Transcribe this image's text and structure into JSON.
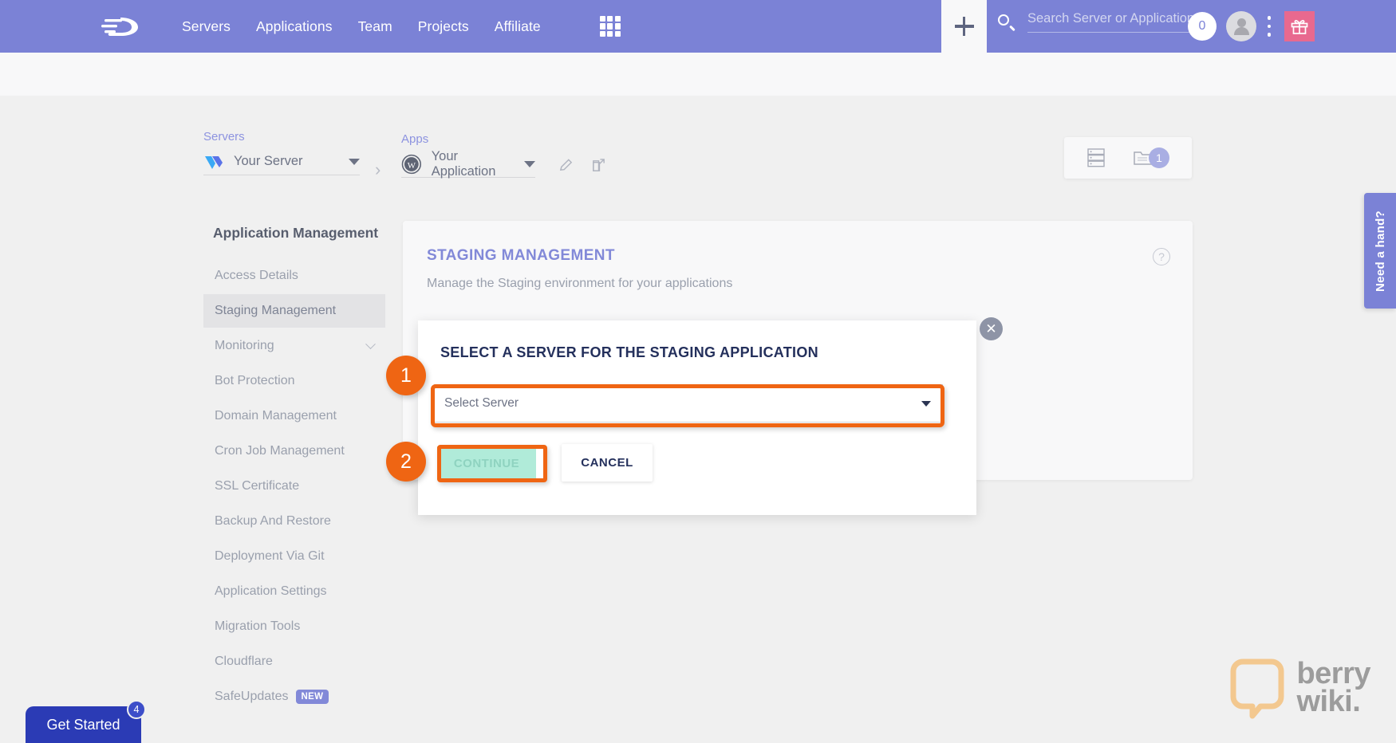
{
  "topnav": {
    "logo": "cloudways-logo",
    "links": [
      {
        "label": "Servers",
        "name": "nav-servers"
      },
      {
        "label": "Applications",
        "name": "nav-applications"
      },
      {
        "label": "Team",
        "name": "nav-team"
      },
      {
        "label": "Projects",
        "name": "nav-projects"
      },
      {
        "label": "Affiliate",
        "name": "nav-affiliate"
      }
    ],
    "grid_icon": "apps-grid-icon",
    "plus_icon": "plus-icon",
    "search": {
      "icon": "search-icon",
      "placeholder": "Search Server or Application",
      "value": ""
    },
    "notification_count": "0",
    "avatar_icon": "user-avatar-icon",
    "kebab_icon": "more-vertical-icon",
    "gift_icon": "gift-icon",
    "bg_color": "#7b82d6",
    "gift_color": "#e8698f"
  },
  "breadcrumb": {
    "server": {
      "label": "Servers",
      "value": "Your Server",
      "icon": "vultr-logo-icon"
    },
    "app": {
      "label": "Apps",
      "value": "Your Application",
      "icon": "wordpress-logo-icon"
    },
    "separator": "›",
    "edit_icon": "pencil-icon",
    "open_icon": "external-link-icon"
  },
  "view_toggle": {
    "list_icon": "server-list-icon",
    "folder_icon": "folder-icon",
    "folder_count": "1"
  },
  "sidebar": {
    "title": "Application Management",
    "items": [
      {
        "label": "Access Details",
        "name": "sidebar-item-access-details",
        "active": false
      },
      {
        "label": "Staging Management",
        "name": "sidebar-item-staging-management",
        "active": true
      },
      {
        "label": "Monitoring",
        "name": "sidebar-item-monitoring",
        "active": false,
        "expandable": true
      },
      {
        "label": "Bot Protection",
        "name": "sidebar-item-bot-protection",
        "active": false
      },
      {
        "label": "Domain Management",
        "name": "sidebar-item-domain-management",
        "active": false
      },
      {
        "label": "Cron Job Management",
        "name": "sidebar-item-cron-job-management",
        "active": false
      },
      {
        "label": "SSL Certificate",
        "name": "sidebar-item-ssl-certificate",
        "active": false
      },
      {
        "label": "Backup And Restore",
        "name": "sidebar-item-backup-and-restore",
        "active": false
      },
      {
        "label": "Deployment Via Git",
        "name": "sidebar-item-deployment-via-git",
        "active": false
      },
      {
        "label": "Application Settings",
        "name": "sidebar-item-application-settings",
        "active": false
      },
      {
        "label": "Migration Tools",
        "name": "sidebar-item-migration-tools",
        "active": false
      },
      {
        "label": "Cloudflare",
        "name": "sidebar-item-cloudflare",
        "active": false
      },
      {
        "label": "SafeUpdates",
        "name": "sidebar-item-safeupdates",
        "active": false,
        "badge": "NEW"
      }
    ]
  },
  "card": {
    "title": "STAGING MANAGEMENT",
    "subtitle": "Manage the Staging environment for your applications",
    "help_icon": "question-mark-icon",
    "title_color": "#8289d8"
  },
  "modal": {
    "title": "SELECT A SERVER FOR THE STAGING APPLICATION",
    "close_icon": "close-x-icon",
    "select": {
      "placeholder": "Select Server",
      "value": "Select Server",
      "caret_icon": "chevron-down-icon"
    },
    "continue_label": "CONTINUE",
    "cancel_label": "CANCEL",
    "continue_bg": "#b0ebd9",
    "continue_fg": "#8fd3c0"
  },
  "annotations": {
    "color": "#ef6513",
    "steps": [
      {
        "number": "1",
        "target": "server-select-dropdown"
      },
      {
        "number": "2",
        "target": "continue-button"
      }
    ]
  },
  "side_tab": {
    "label": "Need a hand?"
  },
  "get_started": {
    "label": "Get Started",
    "badge": "4"
  },
  "watermark": {
    "line1": "berry",
    "line2": "wiki."
  }
}
